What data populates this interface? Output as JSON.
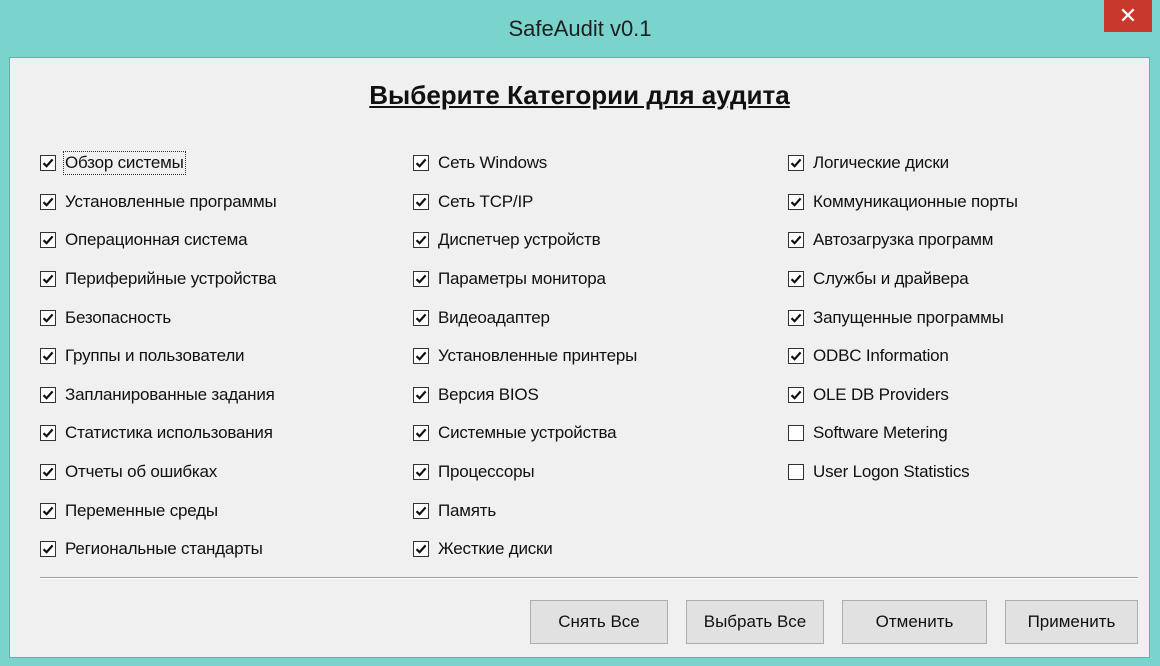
{
  "window": {
    "title": "SafeAudit v0.1",
    "close_glyph": "✕"
  },
  "heading": "Выберите Категории для аудита",
  "columns": [
    [
      {
        "label": "Обзор системы",
        "checked": true,
        "focused": true
      },
      {
        "label": "Установленные программы",
        "checked": true
      },
      {
        "label": "Операционная система",
        "checked": true
      },
      {
        "label": "Периферийные устройства",
        "checked": true
      },
      {
        "label": "Безопасность",
        "checked": true
      },
      {
        "label": "Группы и пользователи",
        "checked": true
      },
      {
        "label": "Запланированные задания",
        "checked": true
      },
      {
        "label": "Статистика использования",
        "checked": true
      },
      {
        "label": "Отчеты об ошибках",
        "checked": true
      },
      {
        "label": "Переменные среды",
        "checked": true
      },
      {
        "label": "Региональные стандарты",
        "checked": true
      }
    ],
    [
      {
        "label": "Сеть Windows",
        "checked": true
      },
      {
        "label": "Сеть TCP/IP",
        "checked": true
      },
      {
        "label": "Диспетчер устройств",
        "checked": true
      },
      {
        "label": "Параметры монитора",
        "checked": true
      },
      {
        "label": "Видеоадаптер",
        "checked": true
      },
      {
        "label": "Установленные принтеры",
        "checked": true
      },
      {
        "label": "Версия BIOS",
        "checked": true
      },
      {
        "label": "Системные устройства",
        "checked": true
      },
      {
        "label": "Процессоры",
        "checked": true
      },
      {
        "label": "Память",
        "checked": true
      },
      {
        "label": "Жесткие диски",
        "checked": true
      }
    ],
    [
      {
        "label": "Логические диски",
        "checked": true
      },
      {
        "label": "Коммуникационные порты",
        "checked": true
      },
      {
        "label": "Автозагрузка программ",
        "checked": true
      },
      {
        "label": "Службы и драйвера",
        "checked": true
      },
      {
        "label": "Запущенные программы",
        "checked": true
      },
      {
        "label": "ODBC Information",
        "checked": true
      },
      {
        "label": "OLE DB Providers",
        "checked": true
      },
      {
        "label": "Software Metering",
        "checked": false
      },
      {
        "label": "User Logon Statistics",
        "checked": false
      }
    ]
  ],
  "buttons": {
    "clear_all": "Снять Все",
    "select_all": "Выбрать Все",
    "cancel": "Отменить",
    "apply": "Применить"
  },
  "colors": {
    "titlebar": "#7ad3cc",
    "close_button": "#c7392c",
    "client_background": "#f0f0f0"
  }
}
